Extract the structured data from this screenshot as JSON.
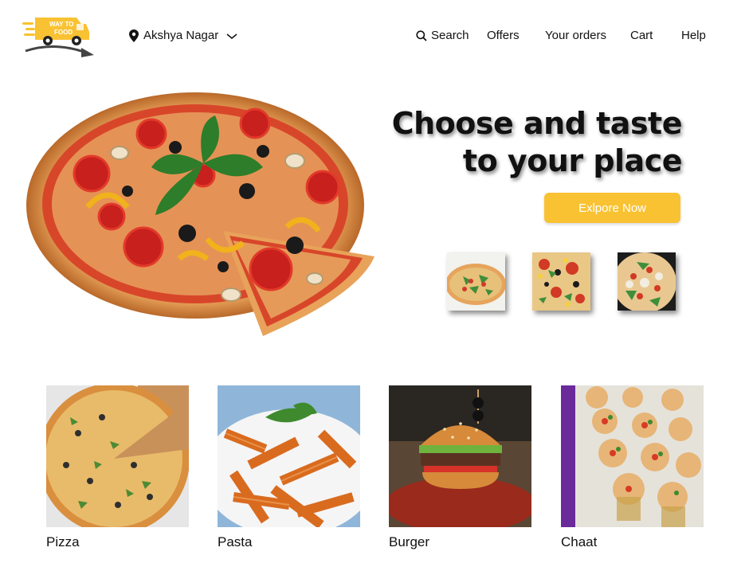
{
  "logo": {
    "text_line1": "WAY TO",
    "text_line2": "FOOD"
  },
  "header": {
    "location": "Akshya Nagar",
    "nav": {
      "search": "Search",
      "offers": "Offers",
      "orders": "Your orders",
      "cart": "Cart",
      "help": "Help"
    }
  },
  "hero": {
    "headline_line1": "Choose and taste",
    "headline_line2": "to your place",
    "cta": "Exlpore Now"
  },
  "categories": [
    {
      "label": "Pizza"
    },
    {
      "label": "Pasta"
    },
    {
      "label": "Burger"
    },
    {
      "label": "Chaat"
    }
  ],
  "colors": {
    "accent": "#f9c232",
    "text": "#111111"
  }
}
